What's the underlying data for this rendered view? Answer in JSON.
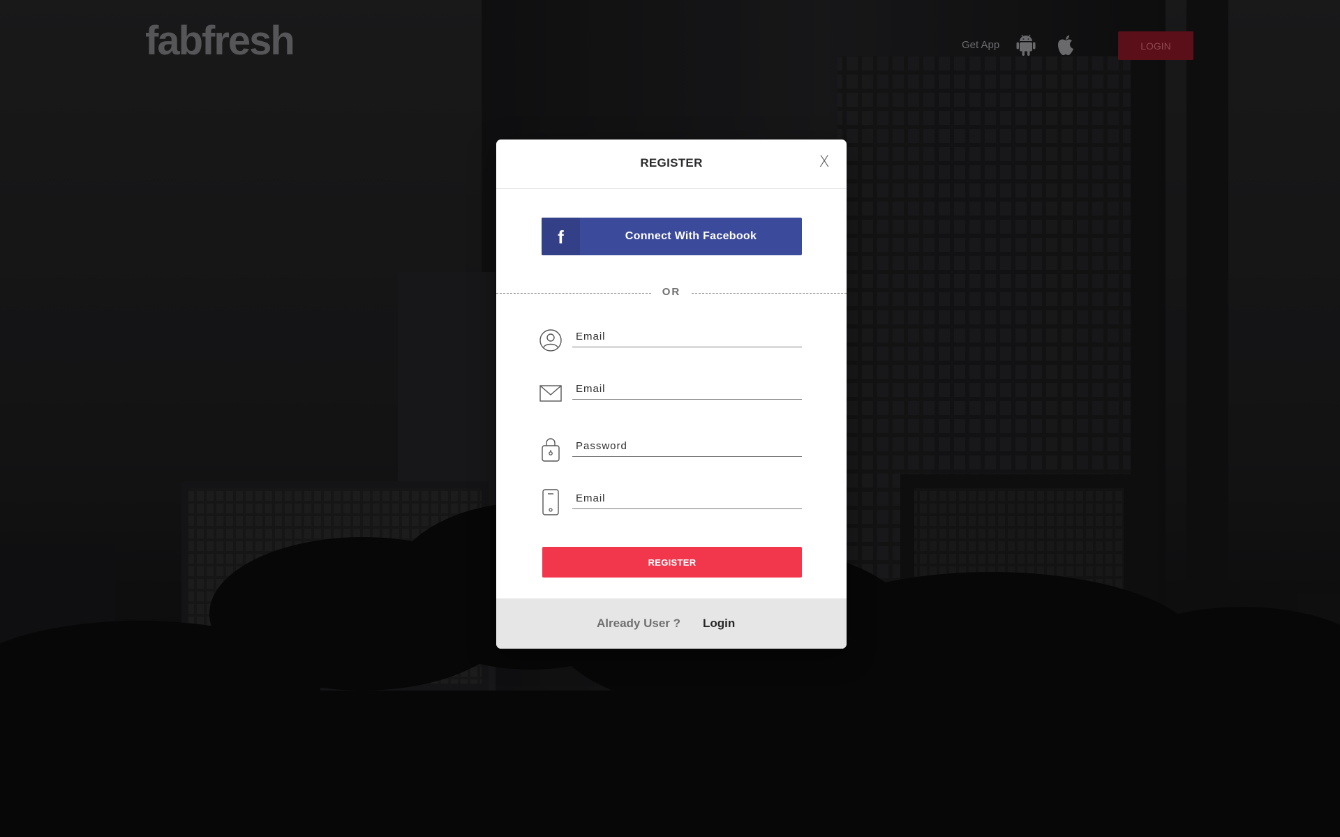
{
  "header": {
    "logo_text": "fabfresh",
    "get_app_label": "Get App",
    "android_icon": "android-icon",
    "apple_icon": "apple-icon",
    "login_label": "LOGIN"
  },
  "modal": {
    "title": "REGISTER",
    "close_label": "X",
    "facebook_icon": "facebook-icon",
    "facebook_label": "Connect With Facebook",
    "or_label": "OR",
    "fields": [
      {
        "icon": "user-icon",
        "placeholder": "Email",
        "value": ""
      },
      {
        "icon": "envelope-icon",
        "placeholder": "Email",
        "value": ""
      },
      {
        "icon": "lock-icon",
        "placeholder": "Password",
        "value": ""
      },
      {
        "icon": "phone-icon",
        "placeholder": "Email",
        "value": ""
      }
    ],
    "register_label": "REGISTER",
    "footer": {
      "already_label": "Already User ?",
      "login_label": "Login"
    }
  },
  "colors": {
    "facebook": "#3b4a9a",
    "register": "#f2374d",
    "top_login": "#5b0f18",
    "footer_bg": "#e6e6e6"
  }
}
